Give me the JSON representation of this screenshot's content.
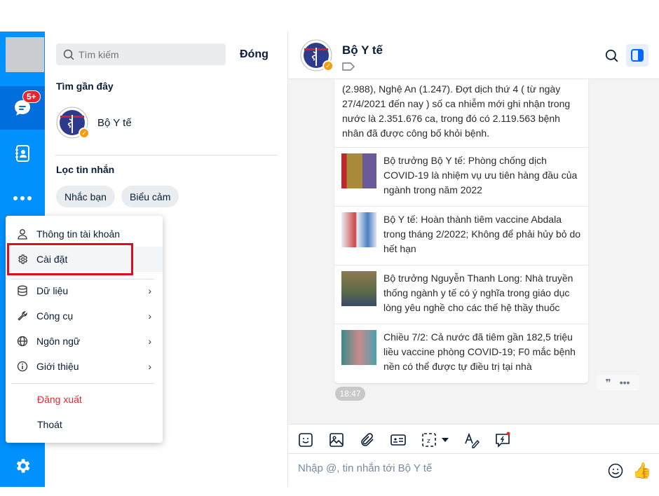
{
  "sidebar": {
    "chat_badge": "5+",
    "accent": "#0091ff"
  },
  "search": {
    "placeholder": "Tìm kiếm",
    "close_label": "Đóng"
  },
  "recent": {
    "title": "Tìm gần đây",
    "items": [
      {
        "name": "Bộ Y tế"
      }
    ]
  },
  "filter": {
    "title": "Lọc tin nhắn",
    "chips": [
      "Nhắc bạn",
      "Biểu cảm"
    ]
  },
  "menu": {
    "items": [
      {
        "label": "Thông tin tài khoản",
        "icon": "user-icon"
      },
      {
        "label": "Cài đặt",
        "icon": "gear-icon"
      },
      {
        "label": "Dữ liệu",
        "icon": "database-icon",
        "submenu": true
      },
      {
        "label": "Công cụ",
        "icon": "wrench-icon",
        "submenu": true
      },
      {
        "label": "Ngôn ngữ",
        "icon": "globe-icon",
        "submenu": true
      },
      {
        "label": "Giới thiệu",
        "icon": "info-icon",
        "submenu": true
      },
      {
        "label": "Đăng xuất",
        "color": "#e0282e"
      },
      {
        "label": "Thoát"
      }
    ]
  },
  "chat": {
    "title": "Bộ Y tế",
    "message_text": "(2.988), Nghệ An (1.247). Đợt dịch thứ 4 ( từ ngày 27/4/2021 đến nay ) số ca nhiễm mới ghi nhận trong nước là 2.351.676 ca, trong đó có 2.119.563 bệnh nhân đã được công bố khỏi bệnh.",
    "articles": [
      {
        "title": "Bộ trưởng Bộ Y tế: Phòng chống dịch COVID-19 là nhiệm vụ ưu tiên hàng đầu của ngành trong năm 2022"
      },
      {
        "title": "Bộ Y tế: Hoàn thành tiêm vaccine Abdala trong tháng 2/2022; Không để phải hủy bỏ do hết hạn"
      },
      {
        "title": "Bộ trưởng Nguyễn Thanh Long: Nhà truyền thống ngành y tế có ý nghĩa trong giáo dục lòng yêu nghề cho các thế hệ thầy thuốc"
      },
      {
        "title": "Chiều 7/2: Cả nước đã tiêm gần 182,5 triệu liều vaccine phòng COVID-19; F0 mắc bệnh nền có thể được tự điều trị tại nhà"
      }
    ],
    "time": "18:47",
    "input_placeholder": "Nhập @, tin nhắn tới Bộ Y tế"
  }
}
